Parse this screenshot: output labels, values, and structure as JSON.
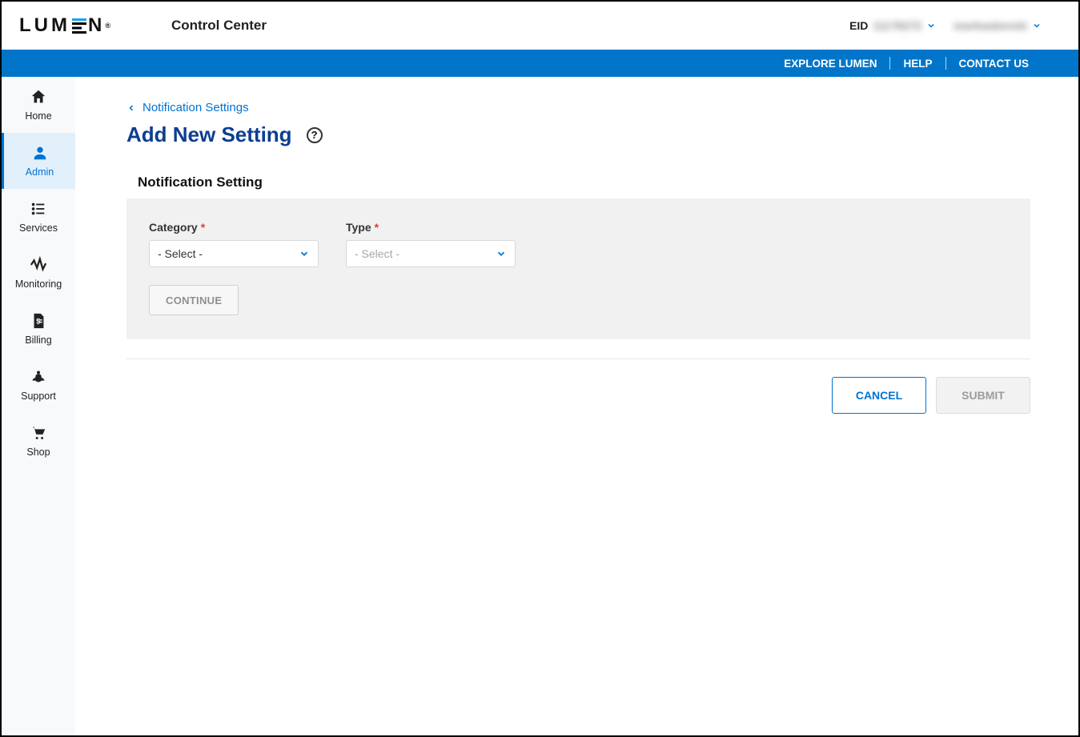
{
  "header": {
    "logo_text_left": "LUM",
    "logo_text_right": "N",
    "reg_mark": "®",
    "app_title": "Control Center",
    "eid_label": "EID",
    "eid_value": "11178272",
    "user_name": "markwalenski"
  },
  "utility_nav": {
    "explore": "EXPLORE LUMEN",
    "help": "HELP",
    "contact": "CONTACT US"
  },
  "sidebar": {
    "items": [
      {
        "label": "Home",
        "icon": "home-icon",
        "active": false
      },
      {
        "label": "Admin",
        "icon": "admin-icon",
        "active": true
      },
      {
        "label": "Services",
        "icon": "services-icon",
        "active": false
      },
      {
        "label": "Monitoring",
        "icon": "monitoring-icon",
        "active": false
      },
      {
        "label": "Billing",
        "icon": "billing-icon",
        "active": false
      },
      {
        "label": "Support",
        "icon": "support-icon",
        "active": false
      },
      {
        "label": "Shop",
        "icon": "shop-icon",
        "active": false
      }
    ]
  },
  "breadcrumb": {
    "back_label": "Notification Settings"
  },
  "page": {
    "title": "Add New Setting",
    "help_glyph": "?"
  },
  "form": {
    "section_title": "Notification Setting",
    "category": {
      "label": "Category",
      "required_mark": "*",
      "value": "- Select -"
    },
    "type": {
      "label": "Type",
      "required_mark": "*",
      "value": "- Select -"
    },
    "continue_label": "CONTINUE"
  },
  "actions": {
    "cancel": "CANCEL",
    "submit": "SUBMIT"
  }
}
